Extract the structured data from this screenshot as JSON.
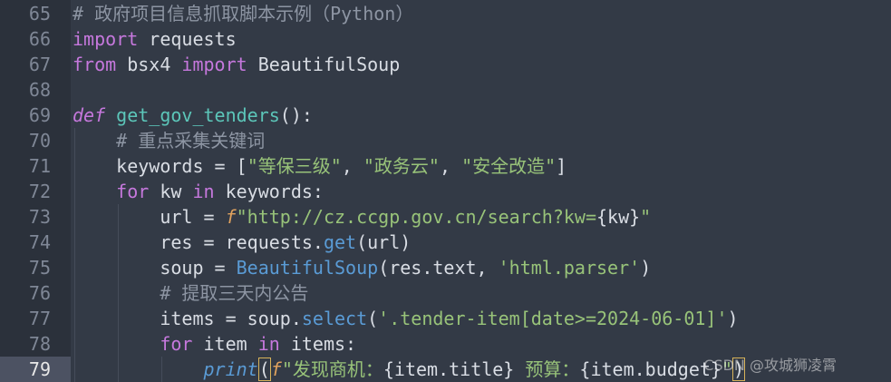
{
  "editor": {
    "lines": [
      {
        "number": "65",
        "tokens": [
          {
            "t": "# 政府项目信息抓取脚本示例（Python）",
            "c": "comment"
          }
        ]
      },
      {
        "number": "66",
        "tokens": [
          {
            "t": "import",
            "c": "kw"
          },
          {
            "t": " requests",
            "c": "plain"
          }
        ]
      },
      {
        "number": "67",
        "tokens": [
          {
            "t": "from",
            "c": "kw"
          },
          {
            "t": " bsx4 ",
            "c": "plain"
          },
          {
            "t": "import",
            "c": "kw"
          },
          {
            "t": " BeautifulSoup",
            "c": "plain"
          }
        ]
      },
      {
        "number": "68",
        "tokens": []
      },
      {
        "number": "69",
        "tokens": [
          {
            "t": "def",
            "c": "def"
          },
          {
            "t": " ",
            "c": "plain"
          },
          {
            "t": "get_gov_tenders",
            "c": "fn"
          },
          {
            "t": "():",
            "c": "plain"
          }
        ]
      },
      {
        "number": "70",
        "indent": 1,
        "tokens": [
          {
            "t": "    # 重点采集关键词",
            "c": "comment"
          }
        ]
      },
      {
        "number": "71",
        "indent": 1,
        "tokens": [
          {
            "t": "    keywords ",
            "c": "plain"
          },
          {
            "t": "=",
            "c": "op"
          },
          {
            "t": " [",
            "c": "plain"
          },
          {
            "t": "\"等保三级\"",
            "c": "str"
          },
          {
            "t": ", ",
            "c": "plain"
          },
          {
            "t": "\"政务云\"",
            "c": "str"
          },
          {
            "t": ", ",
            "c": "plain"
          },
          {
            "t": "\"安全改造\"",
            "c": "str"
          },
          {
            "t": "]",
            "c": "plain"
          }
        ]
      },
      {
        "number": "72",
        "indent": 1,
        "tokens": [
          {
            "t": "    ",
            "c": "plain"
          },
          {
            "t": "for",
            "c": "kw"
          },
          {
            "t": " kw ",
            "c": "plain"
          },
          {
            "t": "in",
            "c": "kw"
          },
          {
            "t": " keywords:",
            "c": "plain"
          }
        ]
      },
      {
        "number": "73",
        "indent": 2,
        "tokens": [
          {
            "t": "        url ",
            "c": "plain"
          },
          {
            "t": "=",
            "c": "op"
          },
          {
            "t": " ",
            "c": "plain"
          },
          {
            "t": "f",
            "c": "fstr"
          },
          {
            "t": "\"http://cz.ccgp.gov.cn/search?kw=",
            "c": "str"
          },
          {
            "t": "{kw}",
            "c": "plain"
          },
          {
            "t": "\"",
            "c": "str"
          }
        ]
      },
      {
        "number": "74",
        "indent": 2,
        "tokens": [
          {
            "t": "        res ",
            "c": "plain"
          },
          {
            "t": "=",
            "c": "op"
          },
          {
            "t": " requests.",
            "c": "plain"
          },
          {
            "t": "get",
            "c": "call"
          },
          {
            "t": "(url)",
            "c": "plain"
          }
        ]
      },
      {
        "number": "75",
        "indent": 2,
        "tokens": [
          {
            "t": "        soup ",
            "c": "plain"
          },
          {
            "t": "=",
            "c": "op"
          },
          {
            "t": " ",
            "c": "plain"
          },
          {
            "t": "BeautifulSoup",
            "c": "call"
          },
          {
            "t": "(res.text, ",
            "c": "plain"
          },
          {
            "t": "'html.parser'",
            "c": "str"
          },
          {
            "t": ")",
            "c": "plain"
          }
        ]
      },
      {
        "number": "76",
        "indent": 2,
        "tokens": [
          {
            "t": "        # 提取三天内公告",
            "c": "comment"
          }
        ]
      },
      {
        "number": "77",
        "indent": 2,
        "tokens": [
          {
            "t": "        items ",
            "c": "plain"
          },
          {
            "t": "=",
            "c": "op"
          },
          {
            "t": " soup.",
            "c": "plain"
          },
          {
            "t": "select",
            "c": "call"
          },
          {
            "t": "(",
            "c": "plain"
          },
          {
            "t": "'.tender-item[date>=2024-06-01]'",
            "c": "str"
          },
          {
            "t": ")",
            "c": "plain"
          }
        ]
      },
      {
        "number": "78",
        "indent": 2,
        "tokens": [
          {
            "t": "        ",
            "c": "plain"
          },
          {
            "t": "for",
            "c": "kw"
          },
          {
            "t": " item ",
            "c": "plain"
          },
          {
            "t": "in",
            "c": "kw"
          },
          {
            "t": " items:",
            "c": "plain"
          }
        ]
      },
      {
        "number": "79",
        "active": true,
        "indent": 3,
        "tokens": [
          {
            "t": "            ",
            "c": "plain"
          },
          {
            "t": "print",
            "c": "print"
          },
          {
            "t": "(",
            "c": "cursor"
          },
          {
            "t": "f",
            "c": "fstr"
          },
          {
            "t": "\"发现商机：",
            "c": "str"
          },
          {
            "t": "{item.title}",
            "c": "plain"
          },
          {
            "t": " 预算：",
            "c": "str"
          },
          {
            "t": "{item.budget}",
            "c": "plain"
          },
          {
            "t": "\"",
            "c": "str"
          },
          {
            "t": ")",
            "c": "cursor"
          }
        ]
      }
    ]
  },
  "watermark": "CSDN @攻城狮凌霄",
  "colors": {
    "background": "#323844",
    "gutter": "#2b313b",
    "keyword": "#c678dd",
    "function_name": "#5cc6b9",
    "call": "#5a9bd5",
    "string": "#98c379",
    "comment": "#8d95a3"
  }
}
